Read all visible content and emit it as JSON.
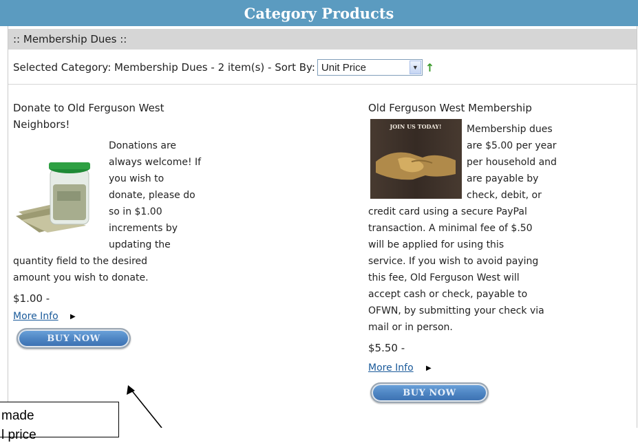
{
  "header": {
    "title": "Category Products"
  },
  "subheader": {
    "label": ":: Membership Dues ::"
  },
  "category_bar": {
    "text": "Selected Category: Membership Dues - 2 item(s) - Sort By:",
    "sort_value": "Unit Price"
  },
  "products": [
    {
      "title_lines": [
        "Donate to Old Ferguson West",
        "Neighbors!"
      ],
      "image_icon": "money-jar-image",
      "description_lines": [
        "Donations are",
        "always welcome! If",
        "you wish to",
        "donate, please do",
        "so in $1.00",
        "increments by",
        "updating the",
        "quantity field to the desired",
        "amount you wish to donate."
      ],
      "price": "$1.00 -",
      "more_info": "More Info",
      "buy_label": "BUY NOW"
    },
    {
      "title_lines": [
        "Old Ferguson West Membership"
      ],
      "image_icon": "handshake-image",
      "image_caption": "JOIN US TODAY!",
      "description_lines": [
        "Membership dues",
        "are $5.00 per year",
        "per household and",
        "are payable by",
        "check, debit, or",
        "credit card using a secure PayPal",
        "transaction.  A minimal fee of $.50",
        "will be applied for using this",
        "service.  If you wish to avoid paying",
        "this fee, Old Ferguson West will",
        "accept cash or check, payable to",
        "OFWN, by submitting your check via",
        "mail or in person."
      ],
      "price": "$5.50 -",
      "more_info": "More Info",
      "buy_label": "BUY NOW"
    }
  ],
  "annotation": {
    "lines": [
      "made",
      "l price"
    ]
  },
  "colors": {
    "header_bg": "#5b9bc0",
    "subheader_bg": "#d6d6d6",
    "link": "#1a5a9a",
    "button": "#4f86c4"
  }
}
